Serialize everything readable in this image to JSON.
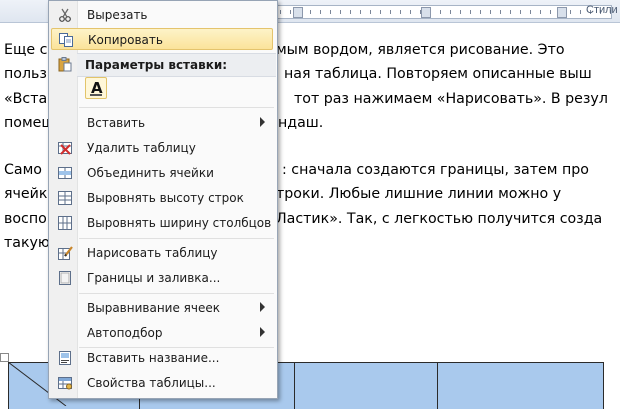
{
  "ribbon": {
    "styles_label": "Стили",
    "dialog_launcher": "▫"
  },
  "document": {
    "lines": [
      "Еще с",
      "польз",
      "«Вста",
      "помеш",
      "Само",
      "ячейк",
      "воспо",
      "такую"
    ],
    "lines_right": [
      "иемым вордом, является рисование. Это",
      "ная таблица. Повторяем описанные выш",
      "тот раз нажимаем «Нарисовать». В резул",
      "ндаш.",
      ": сначала создаются границы, затем про",
      "троки. Любые лишние линии можно у",
      "Ластик». Так, с легкостью получится созда",
      ""
    ]
  },
  "context_menu": {
    "items": [
      {
        "label": "Вырезать",
        "icon": "scissors-icon",
        "highlighted": false,
        "submenu": false
      },
      {
        "label": "Копировать",
        "icon": "copy-icon",
        "highlighted": true,
        "submenu": false
      },
      {
        "label": "Вставить",
        "icon": "",
        "highlighted": false,
        "submenu": true
      },
      {
        "label": "Удалить таблицу",
        "icon": "delete-table-icon",
        "highlighted": false,
        "submenu": false
      },
      {
        "label": "Объединить ячейки",
        "icon": "merge-cells-icon",
        "highlighted": false,
        "submenu": false
      },
      {
        "label": "Выровнять высоту строк",
        "icon": "distribute-rows-icon",
        "highlighted": false,
        "submenu": false
      },
      {
        "label": "Выровнять ширину столбцов",
        "icon": "distribute-columns-icon",
        "highlighted": false,
        "submenu": false
      },
      {
        "label": "Нарисовать таблицу",
        "icon": "draw-table-icon",
        "highlighted": false,
        "submenu": false
      },
      {
        "label": "Границы и заливка...",
        "icon": "borders-shading-icon",
        "highlighted": false,
        "submenu": false
      },
      {
        "label": "Выравнивание ячеек",
        "icon": "",
        "highlighted": false,
        "submenu": true
      },
      {
        "label": "Автоподбор",
        "icon": "",
        "highlighted": false,
        "submenu": true
      },
      {
        "label": "Вставить название...",
        "icon": "insert-caption-icon",
        "highlighted": false,
        "submenu": false
      },
      {
        "label": "Свойства таблицы...",
        "icon": "table-properties-icon",
        "highlighted": false,
        "submenu": false
      }
    ],
    "paste_header": {
      "label": "Параметры вставки:",
      "icon": "clipboard-icon"
    },
    "paste_option": {
      "glyph": "A",
      "icon": "keep-text-only-icon"
    }
  },
  "colors": {
    "menu_highlight": "#fbe39a",
    "table_fill": "#a9c9ed",
    "menu_border": "#97a4b5"
  }
}
